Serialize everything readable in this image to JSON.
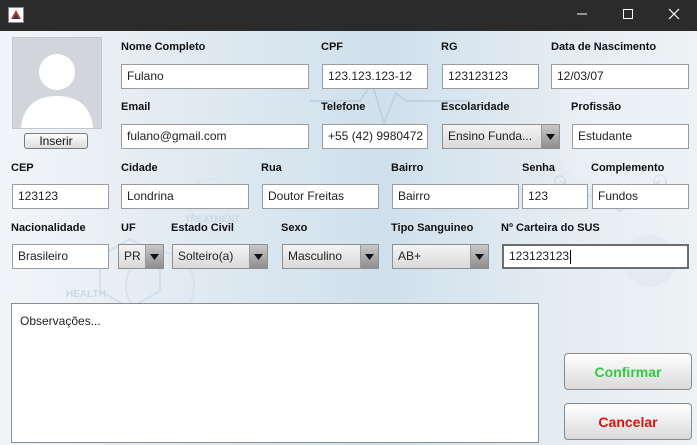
{
  "titlebar": {
    "app_icon": "java-app-icon",
    "minimize_icon": "minimize-icon",
    "maximize_icon": "maximize-icon",
    "close_icon": "close-icon"
  },
  "background_watermarks": [
    "TREATMENT",
    "HEALTH"
  ],
  "photo": {
    "icon": "user-silhouette-icon",
    "insert_label": "Inserir"
  },
  "fields": {
    "nome_completo": {
      "label": "Nome Completo",
      "value": "Fulano"
    },
    "cpf": {
      "label": "CPF",
      "value": "123.123.123-12"
    },
    "rg": {
      "label": "RG",
      "value": "123123123"
    },
    "data_nascimento": {
      "label": "Data de Nascimento",
      "value": "12/03/07"
    },
    "email": {
      "label": "Email",
      "value": "fulano@gmail.com"
    },
    "telefone": {
      "label": "Telefone",
      "value": "+55 (42) 9980472"
    },
    "escolaridade": {
      "label": "Escolaridade",
      "value": "Ensino Funda..."
    },
    "profissao": {
      "label": "Profissão",
      "value": "Estudante"
    },
    "cep": {
      "label": "CEP",
      "value": "123123"
    },
    "cidade": {
      "label": "Cidade",
      "value": "Londrina"
    },
    "rua": {
      "label": "Rua",
      "value": "Doutor Freitas"
    },
    "bairro": {
      "label": "Bairro",
      "value": "Bairro"
    },
    "senha": {
      "label": "Senha",
      "value": "123"
    },
    "complemento": {
      "label": "Complemento",
      "value": "Fundos"
    },
    "nacionalidade": {
      "label": "Nacionalidade",
      "value": "Brasileiro"
    },
    "uf": {
      "label": "UF",
      "value": "PR"
    },
    "estado_civil": {
      "label": "Estado Civil",
      "value": "Solteiro(a)"
    },
    "sexo": {
      "label": "Sexo",
      "value": "Masculino"
    },
    "tipo_sanguineo": {
      "label": "Tipo Sanguineo",
      "value": "AB+"
    },
    "carteira_sus": {
      "label": "Nº Carteira do SUS",
      "value": "123123123"
    }
  },
  "observacoes": {
    "placeholder": "Observações..."
  },
  "buttons": {
    "confirmar": {
      "label": "Confirmar",
      "color": "#2ecc40"
    },
    "cancelar": {
      "label": "Cancelar",
      "color": "#e01010"
    }
  }
}
